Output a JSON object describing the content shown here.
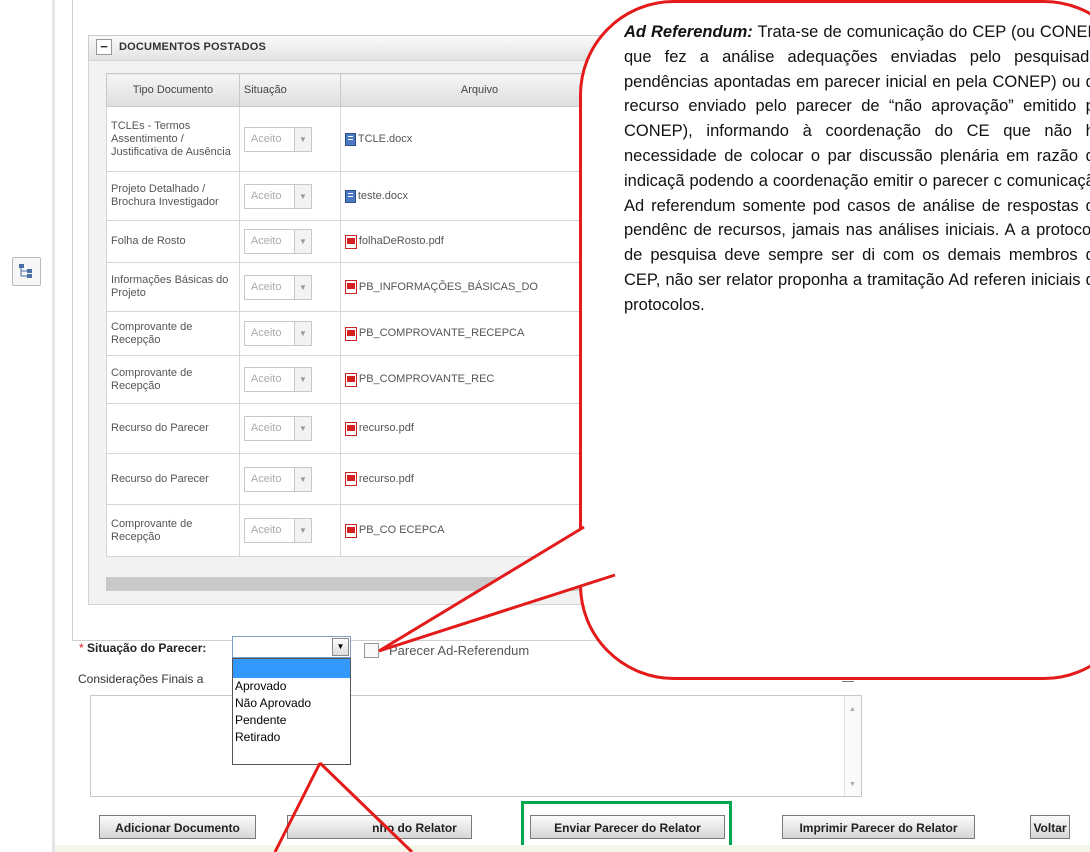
{
  "section": {
    "toggle": "−",
    "title": "DOCUMENTOS POSTADOS"
  },
  "table": {
    "headers": [
      "Tipo Documento",
      "Situação",
      "Arquivo"
    ],
    "rows": [
      {
        "tipo": "TCLEs - Termos Assentimento / Justificativa de Ausência",
        "situacao": "Aceito",
        "arquivo": "TCLE.docx",
        "kind": "doc"
      },
      {
        "tipo": "Projeto Detalhado / Brochura Investigador",
        "situacao": "Aceito",
        "arquivo": "teste.docx",
        "kind": "doc"
      },
      {
        "tipo": "Folha de Rosto",
        "situacao": "Aceito",
        "arquivo": "folhaDeRosto.pdf",
        "kind": "pdf"
      },
      {
        "tipo": "Informações Básicas do Projeto",
        "situacao": "Aceito",
        "arquivo": "PB_INFORMAÇÕES_BÁSICAS_DO",
        "kind": "pdf"
      },
      {
        "tipo": "Comprovante de Recepção",
        "situacao": "Aceito",
        "arquivo": "PB_COMPROVANTE_RECEPCA",
        "kind": "pdf"
      },
      {
        "tipo": "Comprovante de Recepção",
        "situacao": "Aceito",
        "arquivo": "PB_COMPROVANTE_REC",
        "kind": "pdf"
      },
      {
        "tipo": "Recurso do Parecer",
        "situacao": "Aceito",
        "arquivo": "recurso.pdf",
        "kind": "pdf"
      },
      {
        "tipo": "Recurso do Parecer",
        "situacao": "Aceito",
        "arquivo": "recurso.pdf",
        "kind": "pdf"
      },
      {
        "tipo": "Comprovante de Recepção",
        "situacao": "Aceito",
        "arquivo": "PB_CO          ECEPCA",
        "kind": "pdf"
      }
    ]
  },
  "parecer": {
    "required_mark": "*",
    "label": "Situação do Parecer:",
    "selected": "",
    "options": [
      "Aprovado",
      "Não Aprovado",
      "Pendente",
      "Retirado"
    ],
    "adref_label": "Parecer Ad-Referendum"
  },
  "consideracoes": {
    "label": "Considerações Finais a"
  },
  "buttons": {
    "add_document": "Adicionar Documento",
    "save_relator": "nho do Relator",
    "send_parecer": "Enviar Parecer do Relator",
    "print_parecer": "Imprimir Parecer do Relator",
    "back": "Voltar"
  },
  "callout": {
    "emphasis": "Ad Referendum:",
    "text": " Trata-se de comunicação do CEP (ou CONEP) que fez a análise adequações enviadas pelo pesquisador pendências apontadas em parecer inicial en pela CONEP) ou do recurso enviado pelo parecer de “não aprovação” emitido pe CONEP), informando à coordenação do CE que não há necessidade de colocar o par discussão plenária em razão da indicaçã podendo a coordenação emitir o parecer c comunicação Ad referendum somente pod casos de análise de respostas de pendênc de recursos, jamais nas análises iniciais. A a protocolo de pesquisa deve sempre ser di com os demais membros do CEP, não ser relator proponha a tramitação Ad referen iniciais de protocolos."
  },
  "colors": {
    "callout_border": "#e31b1b",
    "highlight_frame": "#00a651",
    "selected_option": "#3399ff"
  },
  "icons": [
    "tree-icon",
    "collapse-icon",
    "docx-icon",
    "pdf-icon",
    "dropdown-arrow-icon",
    "checkbox-icon",
    "expand-icon"
  ]
}
